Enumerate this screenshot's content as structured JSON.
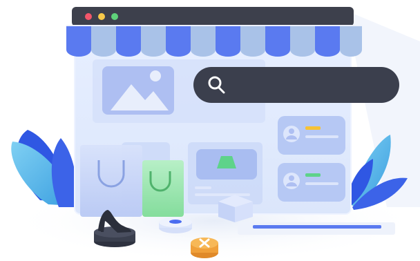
{
  "window": {
    "controls": [
      {
        "name": "close",
        "color": "#f2566a"
      },
      {
        "name": "minimize",
        "color": "#f7c94a"
      },
      {
        "name": "maximize",
        "color": "#5fd27a"
      }
    ]
  },
  "search": {
    "value": "",
    "placeholder": ""
  },
  "colors": {
    "awning_blue": "#5a7af0",
    "awning_light": "#a9c2e8",
    "search_bar": "#3b3f4d",
    "window_bar": "#3d404c",
    "leaf_blue": "#3c63e8",
    "leaf_teal": "#56b6e6",
    "accent_yellow": "#f7c235",
    "accent_green": "#5ed38a",
    "accent_orange": "#f0a03a"
  },
  "icons": [
    "image-placeholder-icon",
    "search-icon",
    "user-avatar-icon",
    "shopping-bag-icon",
    "high-heel-shoe-icon",
    "clothing-icon",
    "gift-box-icon",
    "product-badge-icon"
  ],
  "product_cards": [
    {
      "accent_color": "#f7c235"
    },
    {
      "accent_color": "#5ed38a"
    }
  ]
}
